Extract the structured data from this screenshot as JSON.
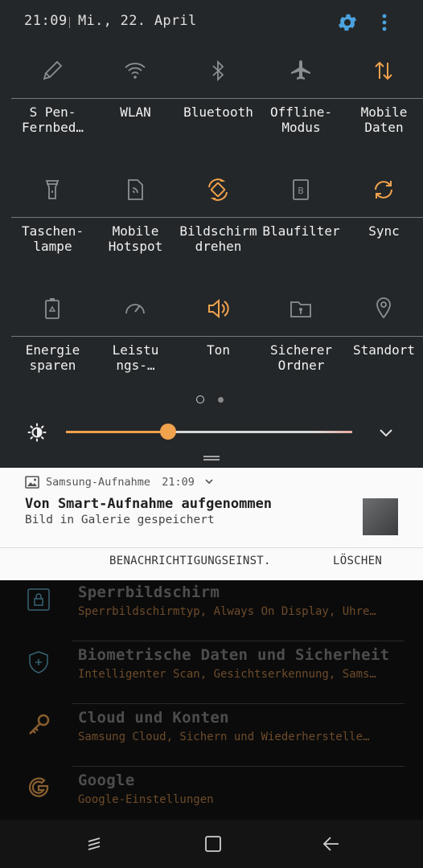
{
  "status": {
    "time": "21:09",
    "date": "Mi., 22. April",
    "icons": [
      "settings-gear-icon",
      "more-vertical-icon"
    ]
  },
  "tiles": [
    {
      "label": "S Pen-\nFernbed…",
      "icon": "pen-icon",
      "active": false
    },
    {
      "label": "WLAN",
      "icon": "wifi-icon",
      "active": false
    },
    {
      "label": "Bluetooth",
      "icon": "bluetooth-icon",
      "active": false
    },
    {
      "label": "Offline-\nModus",
      "icon": "airplane-icon",
      "active": false
    },
    {
      "label": "Mobile\nDaten",
      "icon": "data-arrows-icon",
      "active": true
    },
    {
      "label": "Taschen-\nlampe",
      "icon": "flashlight-icon",
      "active": false
    },
    {
      "label": "Mobile\nHotspot",
      "icon": "hotspot-icon",
      "active": false
    },
    {
      "label": "Bildschirm\ndrehen",
      "icon": "rotate-icon",
      "active": true
    },
    {
      "label": "Blaufilter",
      "icon": "blue-filter-icon",
      "active": false
    },
    {
      "label": "Sync",
      "icon": "sync-icon",
      "active": true
    },
    {
      "label": "Energie\nsparen",
      "icon": "battery-saver-icon",
      "active": false
    },
    {
      "label": "Leistu\nngs-…",
      "icon": "performance-icon",
      "active": false
    },
    {
      "label": "Ton",
      "icon": "sound-icon",
      "active": true
    },
    {
      "label": "Sicherer\nOrdner",
      "icon": "secure-folder-icon",
      "active": false
    },
    {
      "label": "Standort",
      "icon": "location-icon",
      "active": false
    }
  ],
  "brightness": {
    "level": 0.36
  },
  "colors": {
    "accent": "#F1A24D",
    "panel": "#242729",
    "icon_inactive": "#8a8f93"
  },
  "notification": {
    "app": "Samsung-Aufnahme",
    "time": "21:09",
    "title": "Von Smart-Aufnahme aufgenommen",
    "text": "Bild in Galerie gespeichert",
    "actions": [
      "BENACHRICHTIGUNGSEINST.",
      "LÖSCHEN"
    ]
  },
  "settings": [
    {
      "title": "Sperrbildschirm",
      "subtitle": "Sperrbildschirmtyp, Always On Display, Uhre…",
      "icon": "lock-icon"
    },
    {
      "title": "Biometrische Daten und Sicherheit",
      "subtitle": "Intelligenter Scan, Gesichtserkennung, Sams…",
      "icon": "shield-icon"
    },
    {
      "title": "Cloud und Konten",
      "subtitle": "Samsung Cloud, Sichern und Wiederherstelle…",
      "icon": "key-icon"
    },
    {
      "title": "Google",
      "subtitle": "Google-Einstellungen",
      "icon": "google-icon"
    }
  ],
  "navbar": [
    "recents-icon",
    "home-icon",
    "back-icon"
  ]
}
